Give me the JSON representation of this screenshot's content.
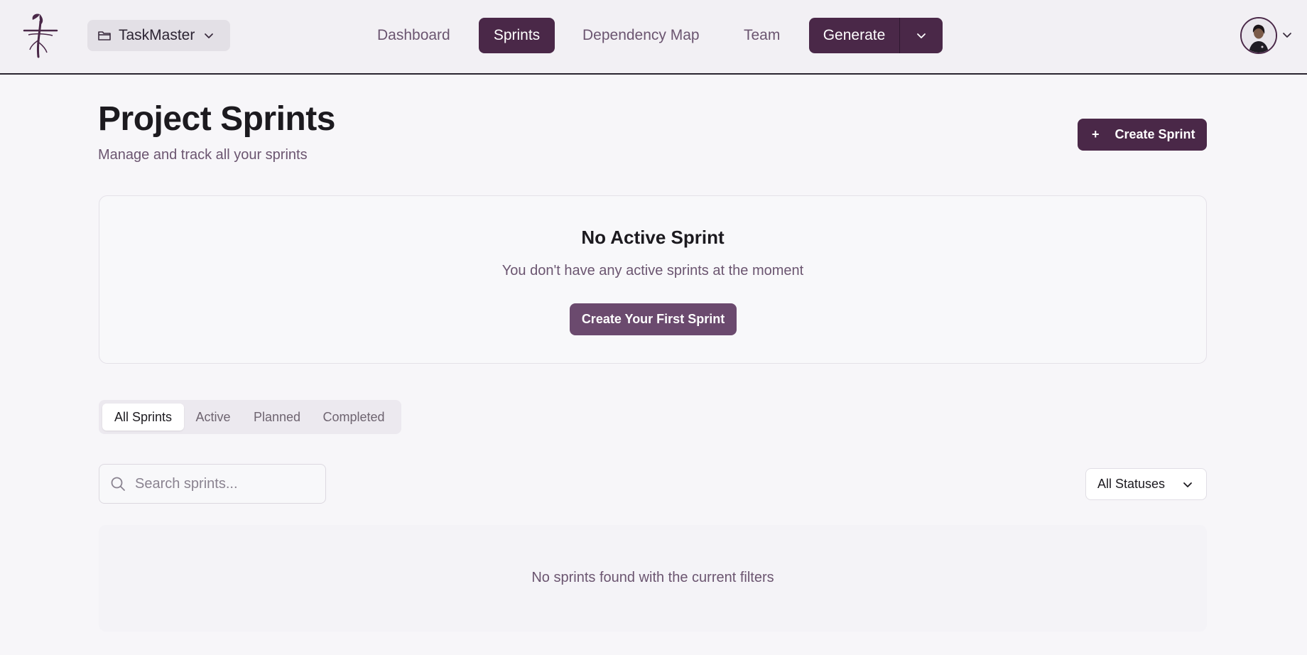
{
  "header": {
    "project_name": "TaskMaster",
    "nav": [
      {
        "label": "Dashboard",
        "active": false
      },
      {
        "label": "Sprints",
        "active": true
      },
      {
        "label": "Dependency Map",
        "active": false
      },
      {
        "label": "Team",
        "active": false
      }
    ],
    "generate_label": "Generate",
    "icons": {
      "logo": "sprout-logo-icon",
      "project": "folder-icon",
      "dropdown": "chevron-down-icon",
      "avatar": "user-avatar"
    }
  },
  "page": {
    "title": "Project Sprints",
    "subtitle": "Manage and track all your sprints",
    "create_button": "Create Sprint",
    "create_button_icon": "+"
  },
  "active_sprint": {
    "title": "No Active Sprint",
    "description": "You don't have any active sprints at the moment",
    "button": "Create Your First Sprint"
  },
  "tabs": [
    {
      "label": "All Sprints",
      "active": true
    },
    {
      "label": "Active",
      "active": false
    },
    {
      "label": "Planned",
      "active": false
    },
    {
      "label": "Completed",
      "active": false
    }
  ],
  "filters": {
    "search_placeholder": "Search sprints...",
    "status_selected": "All Statuses"
  },
  "results": {
    "empty_message": "No sprints found with the current filters"
  },
  "colors": {
    "brand": "#4a2848",
    "brand_muted": "#6b4a6e",
    "muted_text": "#6b5570"
  }
}
